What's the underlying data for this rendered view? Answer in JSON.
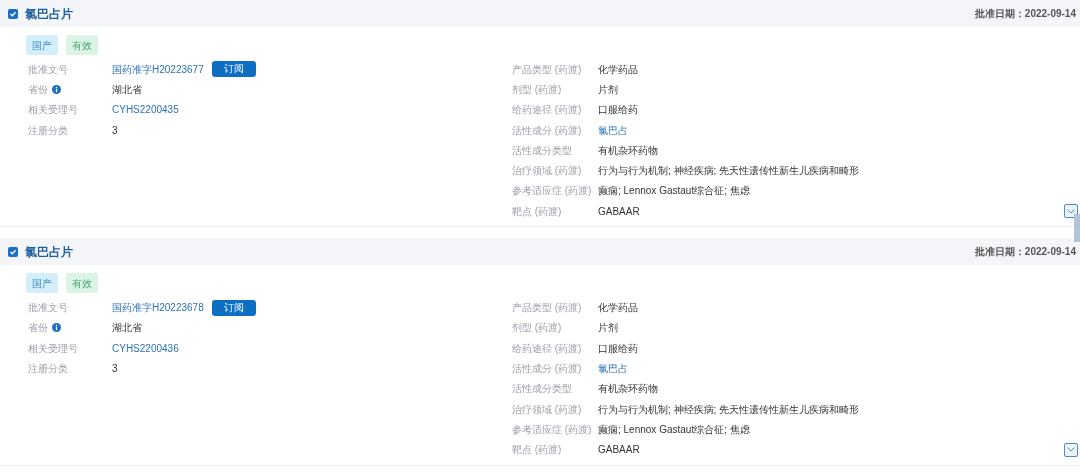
{
  "cards": [
    {
      "checked": true,
      "title": "氯巴占片",
      "date_label": "批准日期：",
      "date": "2022-09-14",
      "tags": [
        {
          "text": "国产",
          "kind": "origin"
        },
        {
          "text": "有效",
          "kind": "status"
        }
      ],
      "left": [
        {
          "label": "批准文号",
          "value": "国药准字H20223677",
          "kind": "link",
          "button": "订阅"
        },
        {
          "label": "省份",
          "value": "湖北省",
          "kind": "text",
          "info": true
        },
        {
          "label": "相关受理号",
          "value": "CYHS2200435",
          "kind": "link"
        },
        {
          "label": "注册分类",
          "value": "3",
          "kind": "text"
        }
      ],
      "right": [
        {
          "label": "产品类型 (药渡)",
          "value": "化学药品",
          "kind": "text"
        },
        {
          "label": "剂型 (药渡)",
          "value": "片剂",
          "kind": "text"
        },
        {
          "label": "给药途径 (药渡)",
          "value": "口服给药",
          "kind": "text"
        },
        {
          "label": "活性成分 (药渡)",
          "value": "氯巴占",
          "kind": "link"
        },
        {
          "label": "活性成分类型",
          "value": "有机杂环药物",
          "kind": "text"
        },
        {
          "label": "治疗领域 (药渡)",
          "value": "行为与行为机制; 神经疾病; 先天性遗传性新生儿疾病和畸形",
          "kind": "text"
        },
        {
          "label": "参考适应症 (药渡)",
          "value": "癫痫; Lennox Gastaut综合征; 焦虑",
          "kind": "text"
        },
        {
          "label": "靶点 (药渡)",
          "value": "GABAAR",
          "kind": "text"
        }
      ]
    },
    {
      "checked": true,
      "title": "氯巴占片",
      "date_label": "批准日期：",
      "date": "2022-09-14",
      "tags": [
        {
          "text": "国产",
          "kind": "origin"
        },
        {
          "text": "有效",
          "kind": "status"
        }
      ],
      "left": [
        {
          "label": "批准文号",
          "value": "国药准字H20223678",
          "kind": "link",
          "button": "订阅"
        },
        {
          "label": "省份",
          "value": "湖北省",
          "kind": "text",
          "info": true
        },
        {
          "label": "相关受理号",
          "value": "CYHS2200436",
          "kind": "link"
        },
        {
          "label": "注册分类",
          "value": "3",
          "kind": "text"
        }
      ],
      "right": [
        {
          "label": "产品类型 (药渡)",
          "value": "化学药品",
          "kind": "text"
        },
        {
          "label": "剂型 (药渡)",
          "value": "片剂",
          "kind": "text"
        },
        {
          "label": "给药途径 (药渡)",
          "value": "口服给药",
          "kind": "text"
        },
        {
          "label": "活性成分 (药渡)",
          "value": "氯巴占",
          "kind": "link"
        },
        {
          "label": "活性成分类型",
          "value": "有机杂环药物",
          "kind": "text"
        },
        {
          "label": "治疗领域 (药渡)",
          "value": "行为与行为机制; 神经疾病; 先天性遗传性新生儿疾病和畸形",
          "kind": "text"
        },
        {
          "label": "参考适应症 (药渡)",
          "value": "癫痫; Lennox Gastaut综合征; 焦虑",
          "kind": "text"
        },
        {
          "label": "靶点 (药渡)",
          "value": "GABAAR",
          "kind": "text"
        }
      ]
    }
  ]
}
